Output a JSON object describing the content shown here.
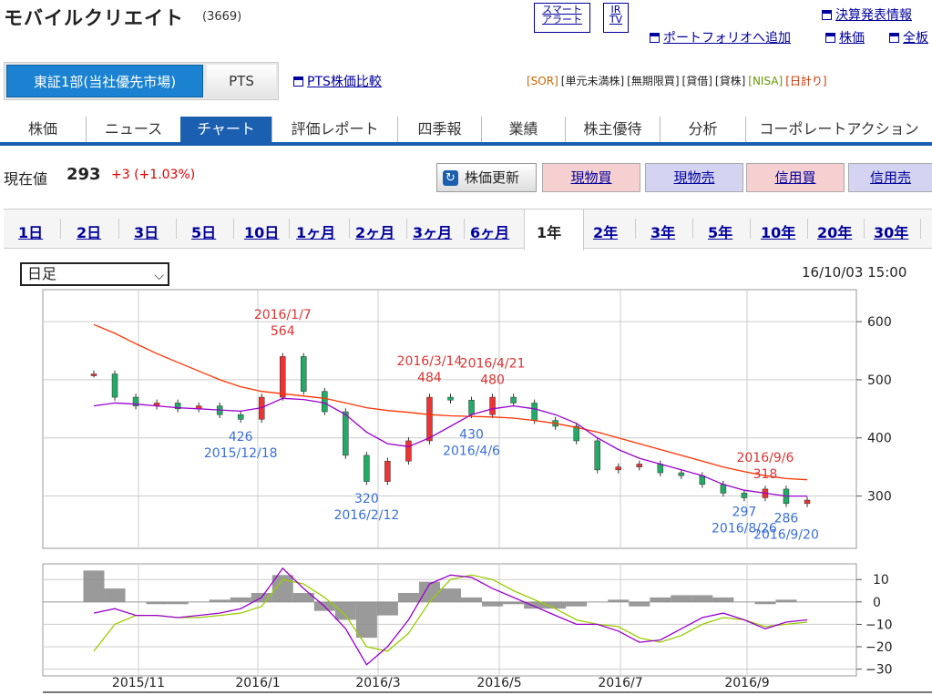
{
  "header": {
    "company": "モバイルクリエイト",
    "code": "(3669)",
    "smart_alert": [
      "スマート",
      "アラート"
    ],
    "ir_tv": [
      "IR",
      "TV"
    ],
    "links": {
      "earnings": "決算発表情報",
      "portfolio": "ポートフォリオへ追加",
      "stock_price": "株価",
      "all": "全板"
    }
  },
  "market": {
    "active_tab": "東証1部(当社優先市場)",
    "pts_tab": "PTS",
    "pts_compare": "PTS株価比較",
    "badges": [
      "[SOR]",
      "[単元未満株]",
      "[無期限買]",
      "[貸借]",
      "[貸株]",
      "[NISA]",
      "[日計り]"
    ],
    "badge_colors": [
      "#cc6600",
      "#333333",
      "#333333",
      "#333333",
      "#333333",
      "#669900",
      "#cc3300"
    ]
  },
  "nav": {
    "tabs": [
      "株価",
      "ニュース",
      "チャート",
      "評価レポート",
      "四季報",
      "業績",
      "株主優待",
      "分析",
      "コーポレートアクション"
    ],
    "active_index": 2
  },
  "quote": {
    "label": "現在値",
    "price": "293",
    "change": "+3 (+1.03%)"
  },
  "actions": {
    "refresh": "株価更新",
    "buy_cash": "現物買",
    "sell_cash": "現物売",
    "buy_margin": "信用買",
    "sell_margin": "信用売"
  },
  "periods": {
    "items": [
      "1日",
      "2日",
      "3日",
      "5日",
      "10日",
      "1ヶ月",
      "2ヶ月",
      "3ヶ月",
      "6ヶ月",
      "1年",
      "2年",
      "3年",
      "5年",
      "10年",
      "20年",
      "30年"
    ],
    "active": "1年"
  },
  "chart_controls": {
    "interval": "日足",
    "timestamp": "16/10/03 15:00"
  },
  "chart_data": [
    {
      "type": "line",
      "title": "",
      "x_tick_labels": [
        "2015/11",
        "2016/1",
        "2016/3",
        "2016/5",
        "2016/7",
        "2016/9"
      ],
      "y_ticks": [
        300,
        400,
        500,
        600
      ],
      "ylim": [
        210,
        655
      ],
      "grid": true,
      "x": [
        "2015/10/05",
        "2015/10/15",
        "2015/10/26",
        "2015/11/05",
        "2015/11/16",
        "2015/11/26",
        "2015/12/07",
        "2015/12/18",
        "2015/12/30",
        "2016/01/07",
        "2016/01/15",
        "2016/01/25",
        "2016/02/04",
        "2016/02/12",
        "2016/02/22",
        "2016/03/03",
        "2016/03/14",
        "2016/03/24",
        "2016/04/06",
        "2016/04/21",
        "2016/05/02",
        "2016/05/13",
        "2016/05/24",
        "2016/06/03",
        "2016/06/14",
        "2016/06/24",
        "2016/07/05",
        "2016/07/15",
        "2016/07/26",
        "2016/08/05",
        "2016/08/16",
        "2016/08/26",
        "2016/09/06",
        "2016/09/20",
        "2016/09/30"
      ],
      "series": [
        {
          "name": "",
          "color": "#555555",
          "values": [
            510,
            470,
            455,
            460,
            450,
            455,
            440,
            432,
            470,
            540,
            480,
            445,
            370,
            325,
            360,
            395,
            470,
            465,
            440,
            470,
            460,
            430,
            420,
            395,
            345,
            350,
            355,
            340,
            335,
            320,
            305,
            297,
            312,
            287,
            293
          ]
        },
        {
          "name": "",
          "color": "#9900cc",
          "values": [
            455,
            460,
            458,
            455,
            452,
            450,
            448,
            446,
            452,
            468,
            466,
            460,
            440,
            410,
            390,
            385,
            400,
            420,
            440,
            450,
            455,
            450,
            440,
            425,
            400,
            380,
            365,
            355,
            345,
            335,
            320,
            310,
            305,
            300,
            300
          ]
        },
        {
          "name": "",
          "color": "#ff3300",
          "values": [
            595,
            580,
            562,
            545,
            530,
            515,
            500,
            488,
            480,
            476,
            472,
            468,
            460,
            452,
            447,
            444,
            440,
            438,
            437,
            436,
            434,
            430,
            425,
            418,
            410,
            400,
            390,
            380,
            370,
            360,
            350,
            342,
            335,
            330,
            328
          ]
        }
      ],
      "annotations": [
        {
          "date": "2016/1/7",
          "value": 564,
          "kind": "high"
        },
        {
          "date": "2015/12/18",
          "value": 426,
          "kind": "low"
        },
        {
          "date": "2016/2/12",
          "value": 320,
          "kind": "low"
        },
        {
          "date": "2016/3/14",
          "value": 484,
          "kind": "high"
        },
        {
          "date": "2016/4/21",
          "value": 480,
          "kind": "high"
        },
        {
          "date": "2016/4/6",
          "value": 430,
          "kind": "low"
        },
        {
          "date": "2016/9/6",
          "value": 318,
          "kind": "high"
        },
        {
          "date": "2016/8/26",
          "value": 297,
          "kind": "low"
        },
        {
          "date": "2016/9/20",
          "value": 286,
          "kind": "low"
        }
      ]
    },
    {
      "type": "line",
      "title": "",
      "y_ticks": [
        10,
        0,
        -10,
        -20,
        -30
      ],
      "ylim": [
        -33,
        17
      ],
      "grid": true,
      "series": [
        {
          "name": "",
          "color": "#9900cc",
          "values": [
            -5,
            -3,
            -6,
            -6,
            -7,
            -6,
            -5,
            -3,
            2,
            15,
            6,
            -2,
            -12,
            -28,
            -20,
            -8,
            8,
            12,
            11,
            6,
            2,
            -2,
            -6,
            -10,
            -10,
            -13,
            -18,
            -17,
            -12,
            -7,
            -5,
            -8,
            -12,
            -9,
            -8
          ]
        },
        {
          "name": "",
          "color": "#99cc00",
          "values": [
            -22,
            -10,
            -6,
            -6,
            -7,
            -7,
            -6,
            -5,
            -2,
            10,
            8,
            2,
            -6,
            -20,
            -22,
            -14,
            0,
            10,
            12,
            10,
            5,
            1,
            -3,
            -8,
            -10,
            -11,
            -16,
            -18,
            -15,
            -10,
            -7,
            -8,
            -11,
            -10,
            -9
          ]
        },
        {
          "name": "",
          "color": "#888888",
          "kind": "histogram",
          "values": [
            14,
            6,
            0,
            -1,
            -1,
            0,
            1,
            2,
            4,
            12,
            4,
            -4,
            -8,
            -16,
            -6,
            4,
            9,
            6,
            2,
            -2,
            -1,
            -3,
            -3,
            -2,
            0,
            1,
            -2,
            2,
            3,
            3,
            2,
            0,
            -1,
            1,
            0
          ]
        }
      ]
    }
  ]
}
